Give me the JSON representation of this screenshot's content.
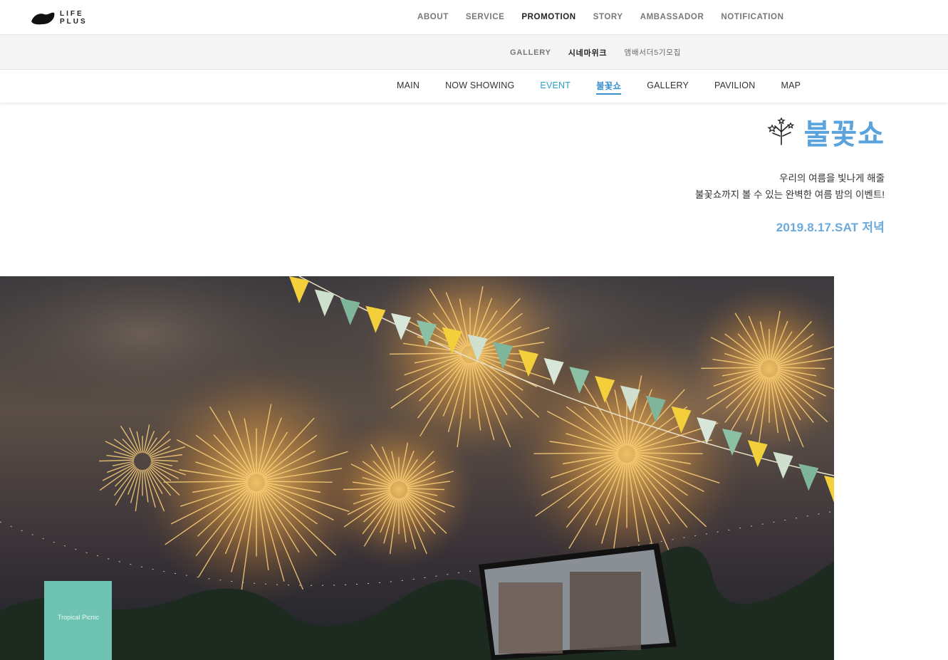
{
  "brand": {
    "logo_line1": "LIFE",
    "logo_line2": "PLUS"
  },
  "main_nav": [
    {
      "label": "ABOUT"
    },
    {
      "label": "SERVICE"
    },
    {
      "label": "PROMOTION",
      "active": true
    },
    {
      "label": "STORY"
    },
    {
      "label": "AMBASSADOR"
    },
    {
      "label": "NOTIFICATION"
    }
  ],
  "sub_nav": [
    {
      "label": "GALLERY"
    },
    {
      "label": "시네마위크",
      "active": true
    },
    {
      "label": "앰배서더5기모집"
    }
  ],
  "third_nav": [
    {
      "label": "MAIN"
    },
    {
      "label": "NOW SHOWING"
    },
    {
      "label": "EVENT"
    },
    {
      "label": "불꽃쇼",
      "current": true
    },
    {
      "label": "GALLERY"
    },
    {
      "label": "PAVILION"
    },
    {
      "label": "MAP"
    }
  ],
  "hero": {
    "icon": "fireworks-icon",
    "title": "불꽃쇼",
    "desc_line1": "우리의 여름을 빛나게 해줄",
    "desc_line2": "불꽃쇼까지 볼 수 있는 완벽한 여름 밤의 이벤트!",
    "date": "2019.8.17.SAT 저녁"
  },
  "photo": {
    "banner_text": "Tropical Picnic",
    "alt_icon": "fireworks-photo"
  },
  "colors": {
    "accent": "#5aa3dc",
    "event_link": "#2aa0c8",
    "nav_text": "#777777",
    "active_text": "#222222"
  }
}
